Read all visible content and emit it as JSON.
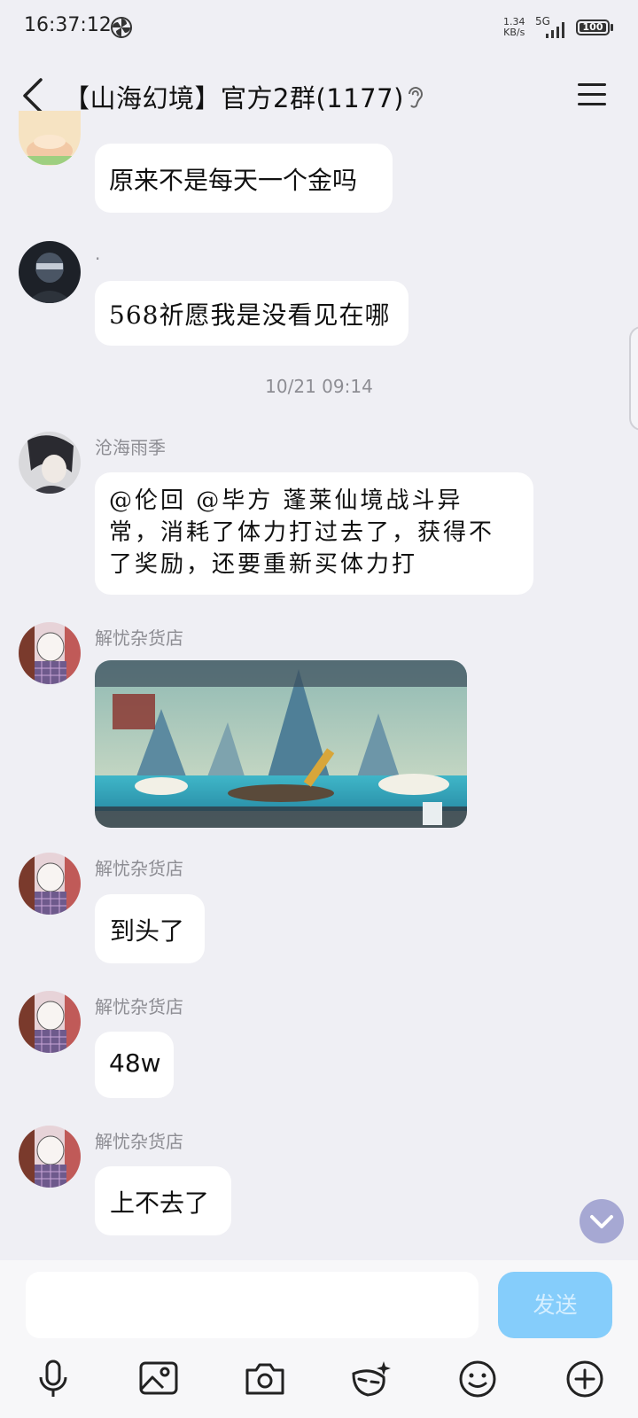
{
  "status_bar": {
    "time": "16:37:12",
    "net_speed": "1.34",
    "net_unit": "KB/s",
    "network": "5G",
    "battery": "100"
  },
  "header": {
    "title": "【山海幻境】官方2群(1177)"
  },
  "chat": {
    "timestamp": "10/21 09:14",
    "messages": [
      {
        "nick": "",
        "text": "原来不是每天一个金吗"
      },
      {
        "nick": ".",
        "text": "568祈愿我是没看见在哪"
      },
      {
        "nick": "沧海雨季",
        "lines": [
          "@伦回 @毕方 蓬莱仙境战斗异",
          "常，消耗了体力打过去了，获得不",
          "了奖励，还要重新买体力打"
        ]
      },
      {
        "nick": "解忧杂货店",
        "image": "game-screenshot"
      },
      {
        "nick": "解忧杂货店",
        "text": "到头了"
      },
      {
        "nick": "解忧杂货店",
        "text": "48w"
      },
      {
        "nick": "解忧杂货店",
        "text": "上不去了"
      }
    ]
  },
  "input_bar": {
    "placeholder": "",
    "send_label": "发送"
  },
  "toolbar": {
    "icons": [
      "microphone-icon",
      "image-icon",
      "camera-icon",
      "mask-icon",
      "emoji-icon",
      "plus-icon"
    ]
  },
  "colors": {
    "background": "#efeff4",
    "bubble": "#ffffff",
    "send_button": "#85cdfb",
    "scroll_button": "#a6a8d3"
  }
}
